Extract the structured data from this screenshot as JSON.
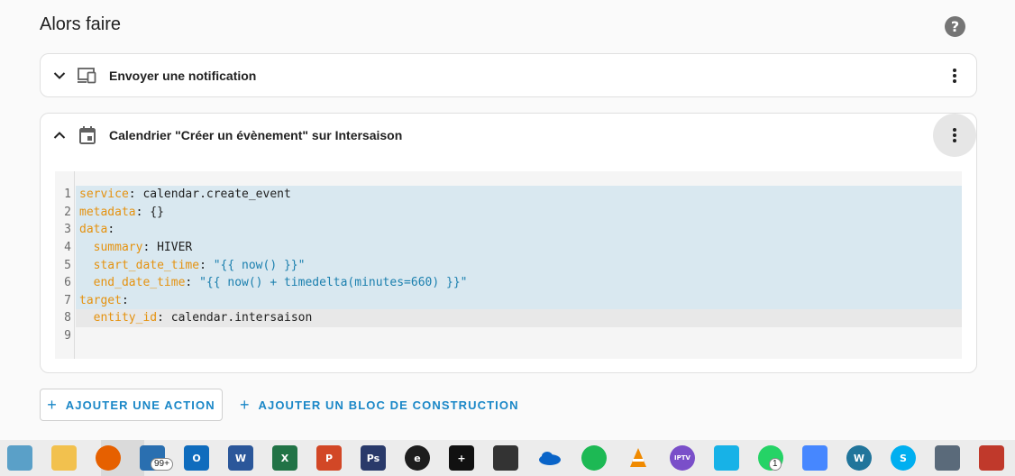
{
  "section": {
    "title": "Alors faire",
    "help_symbol": "?"
  },
  "actions": [
    {
      "title": "Envoyer une notification",
      "icon": "devices-icon",
      "expanded": false
    },
    {
      "title": "Calendrier \"Créer un évènement\" sur Intersaison",
      "icon": "calendar-icon",
      "expanded": true
    }
  ],
  "editor": {
    "lines": [
      {
        "num": "1",
        "key": "service",
        "sep": ": ",
        "value": "calendar.create_event",
        "value_type": "plain",
        "indent": ""
      },
      {
        "num": "2",
        "key": "metadata",
        "sep": ": ",
        "value": "{}",
        "value_type": "plain",
        "indent": ""
      },
      {
        "num": "3",
        "key": "data",
        "sep": ":",
        "value": "",
        "value_type": "plain",
        "indent": ""
      },
      {
        "num": "4",
        "key": "summary",
        "sep": ": ",
        "value": "HIVER",
        "value_type": "plain",
        "indent": "  "
      },
      {
        "num": "5",
        "key": "start_date_time",
        "sep": ": ",
        "value": "\"{{ now() }}\"",
        "value_type": "string",
        "indent": "  "
      },
      {
        "num": "6",
        "key": "end_date_time",
        "sep": ": ",
        "value": "\"{{ now() + timedelta(minutes=660) }}\"",
        "value_type": "string",
        "indent": "  "
      },
      {
        "num": "7",
        "key": "target",
        "sep": ":",
        "value": "",
        "value_type": "plain",
        "indent": ""
      },
      {
        "num": "8",
        "key": "entity_id",
        "sep": ": ",
        "value": "calendar.intersaison",
        "value_type": "plain",
        "indent": "  "
      },
      {
        "num": "9",
        "key": "",
        "sep": "",
        "value": "",
        "value_type": "plain",
        "indent": ""
      }
    ]
  },
  "buttons": {
    "add_action": "AJOUTER UNE ACTION",
    "add_building_block": "AJOUTER UN BLOC DE CONSTRUCTION"
  },
  "taskbar": {
    "items": [
      {
        "name": "tablet-app-icon",
        "color": "#5aa0c8"
      },
      {
        "name": "file-explorer-icon",
        "color": "#f2c14e"
      },
      {
        "name": "firefox-icon",
        "color": "#e66000"
      },
      {
        "name": "mail-icon",
        "color": "#2a6fb0",
        "badge": "99+"
      },
      {
        "name": "outlook-icon",
        "color": "#0f6cbd",
        "letter": "O"
      },
      {
        "name": "word-icon",
        "color": "#2b579a",
        "letter": "W"
      },
      {
        "name": "excel-icon",
        "color": "#217346",
        "letter": "X"
      },
      {
        "name": "powerpoint-icon",
        "color": "#d24726",
        "letter": "P"
      },
      {
        "name": "photoshop-icon",
        "color": "#2a3a6a",
        "letter": "Ps"
      },
      {
        "name": "e-app-icon",
        "color": "#1d1d1d",
        "letter": "e"
      },
      {
        "name": "plus-app-icon",
        "color": "#111111",
        "letter": "+"
      },
      {
        "name": "video-editor-icon",
        "color": "#333333"
      },
      {
        "name": "onedrive-icon",
        "color": "#0a64c8"
      },
      {
        "name": "spotify-icon",
        "color": "#1db954"
      },
      {
        "name": "vlc-icon",
        "color": "#f08a00"
      },
      {
        "name": "iptv-icon",
        "color": "#7a4fc9",
        "letter": "IPTV"
      },
      {
        "name": "kodi-icon",
        "color": "#17b2e7"
      },
      {
        "name": "whatsapp-icon",
        "color": "#25d366",
        "badge": "1"
      },
      {
        "name": "nordvpn-icon",
        "color": "#4687ff"
      },
      {
        "name": "wordpress-icon",
        "color": "#21759b",
        "letter": "W"
      },
      {
        "name": "skype-icon",
        "color": "#00aff0",
        "letter": "S"
      },
      {
        "name": "calculator-icon",
        "color": "#5a6a7a"
      },
      {
        "name": "extra-app-icon",
        "color": "#c0392b"
      }
    ]
  }
}
